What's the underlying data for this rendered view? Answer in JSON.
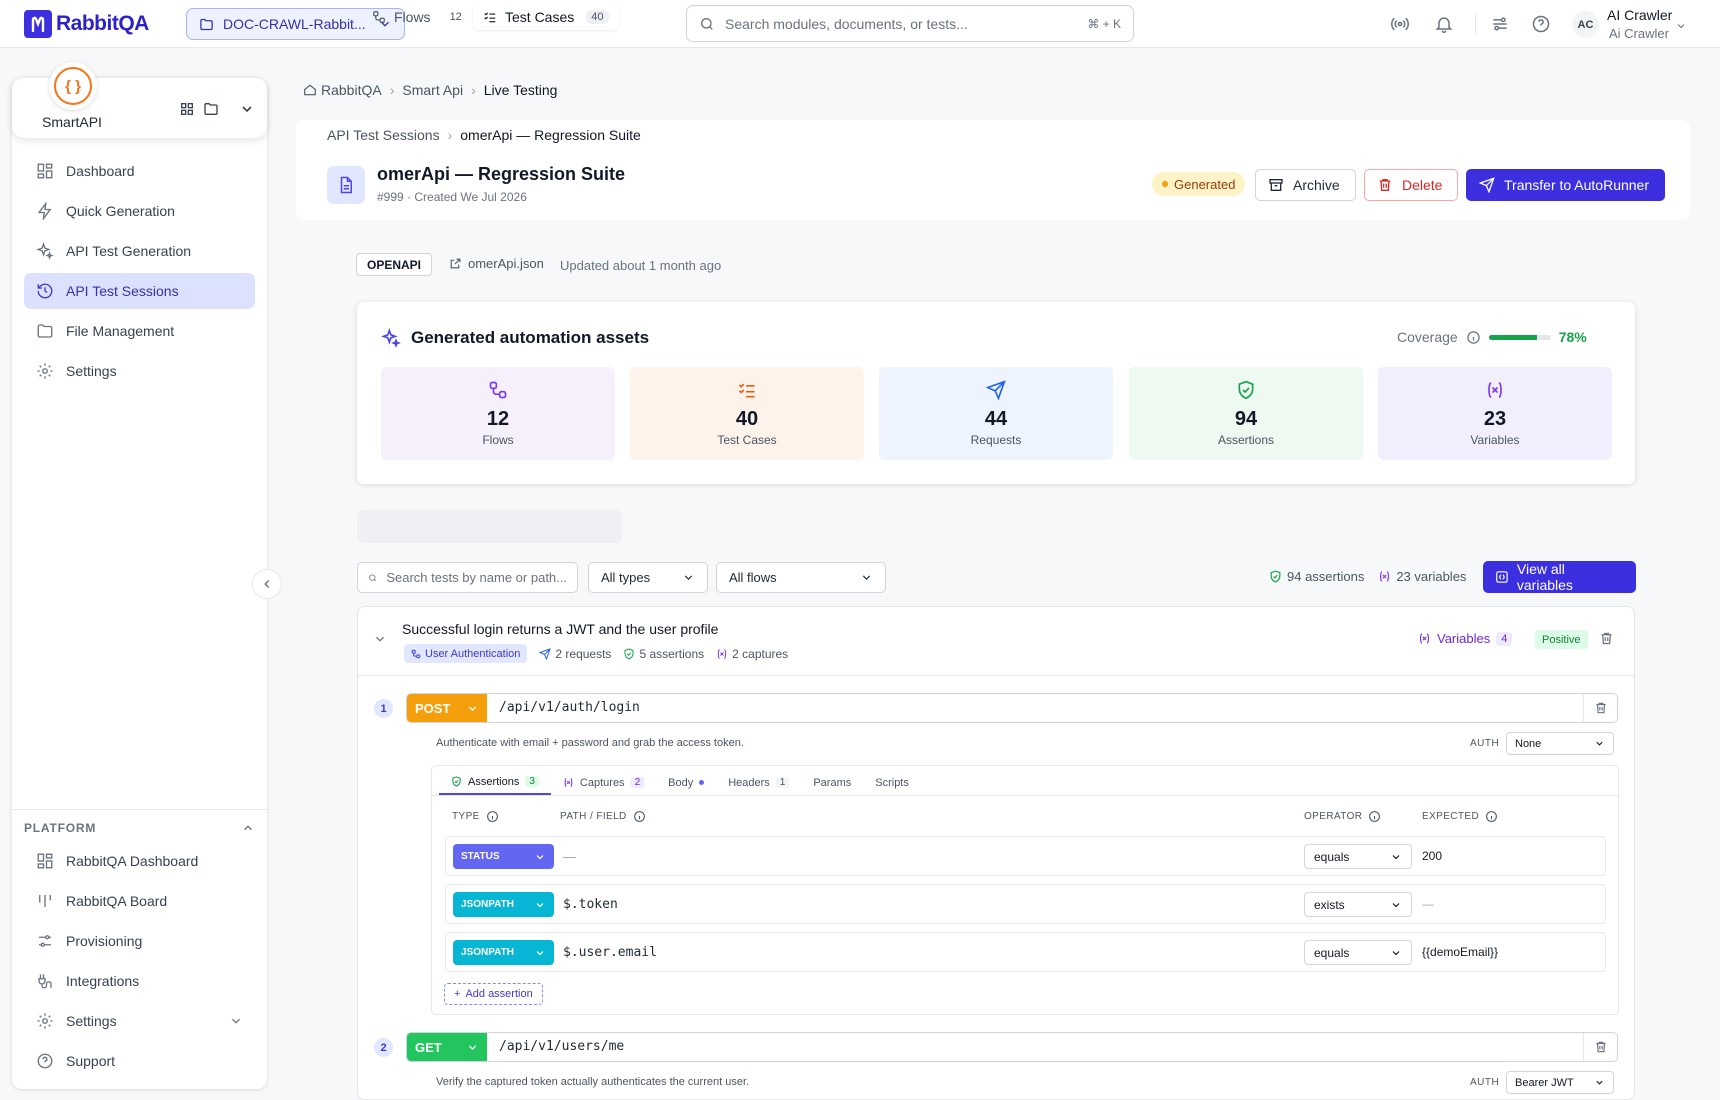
{
  "topbar": {
    "logo_text": "RabbitQA",
    "project_selector": "DOC-CRAWL-Rabbit...",
    "search_placeholder": "Search modules, documents, or tests...",
    "search_shortcut": "⌘ + K",
    "user_initials": "AC",
    "user_name": "AI Crawler",
    "user_subtitle": "Ai Crawler"
  },
  "sidebar": {
    "app_name": "SmartAPI",
    "app_icon_glyph": "{ }",
    "items": [
      {
        "label": "Dashboard",
        "icon": "dashboard-icon"
      },
      {
        "label": "Quick Generation",
        "icon": "bolt-icon"
      },
      {
        "label": "API Test Generation",
        "icon": "sparkles-icon"
      },
      {
        "label": "API Test Sessions",
        "icon": "history-icon",
        "active": true
      },
      {
        "label": "File Management",
        "icon": "folder-icon"
      },
      {
        "label": "Settings",
        "icon": "gear-icon"
      }
    ],
    "platform_heading": "PLATFORM",
    "platform_items": [
      {
        "label": "RabbitQA Dashboard",
        "icon": "dashboard-icon"
      },
      {
        "label": "RabbitQA Board",
        "icon": "board-icon"
      },
      {
        "label": "Provisioning",
        "icon": "sliders-icon"
      },
      {
        "label": "Integrations",
        "icon": "integrations-icon"
      },
      {
        "label": "Settings",
        "icon": "gear-icon"
      },
      {
        "label": "Support",
        "icon": "help-icon"
      }
    ]
  },
  "breadcrumb": [
    "RabbitQA",
    "Smart Api",
    "Live Testing"
  ],
  "session": {
    "breadcrumb_parent": "API Test Sessions",
    "breadcrumb_current": "omerApi — Regression Suite",
    "title": "omerApi — Regression Suite",
    "meta": "#999 · Created We Jul 2026",
    "status": "Generated",
    "archive_label": "Archive",
    "delete_label": "Delete",
    "transfer_label": "Transfer to AutoRunner",
    "spec_type": "OPENAPI",
    "spec_file": "omerApi.json",
    "updated": "Updated about 1 month ago"
  },
  "assets": {
    "title": "Generated automation assets",
    "coverage_label": "Coverage",
    "coverage_value": "78%",
    "coverage_fraction": 0.78,
    "stats": [
      {
        "value": "12",
        "label": "Flows",
        "icon": "flows-icon",
        "bg": "#f6f0fd",
        "color": "#7c3aed"
      },
      {
        "value": "40",
        "label": "Test Cases",
        "icon": "checklist-icon",
        "bg": "#fdf3eb",
        "color": "#ea580c"
      },
      {
        "value": "44",
        "label": "Requests",
        "icon": "send-icon",
        "bg": "#eef4fd",
        "color": "#2563eb"
      },
      {
        "value": "94",
        "label": "Assertions",
        "icon": "shield-check-icon",
        "bg": "#edf9f1",
        "color": "#16a34a"
      },
      {
        "value": "23",
        "label": "Variables",
        "icon": "variable-icon",
        "bg": "#f1effd",
        "color": "#7c3aed"
      }
    ]
  },
  "tabs": [
    {
      "label": "Flows",
      "count": "12"
    },
    {
      "label": "Test Cases",
      "count": "40",
      "active": true
    }
  ],
  "filters": {
    "search_placeholder": "Search tests by name or path...",
    "type_value": "All types",
    "flow_value": "All flows",
    "assertions_count": "94 assertions",
    "variables_count": "23 variables",
    "view_all_label": "View all variables"
  },
  "test_case": {
    "title": "Successful login returns a JWT and the user profile",
    "flow_tag": "User Authentication",
    "requests": "2 requests",
    "assertions": "5 assertions",
    "captures": "2 captures",
    "variables_label": "Variables",
    "variables_count": "4",
    "polarity": "Positive",
    "steps": [
      {
        "num": "1",
        "method": "POST",
        "method_color": "#f59e0b",
        "path": "/api/v1/auth/login",
        "description": "Authenticate with email + password and grab the access token.",
        "auth_label": "AUTH",
        "auth": "None"
      },
      {
        "num": "2",
        "method": "GET",
        "method_color": "#22c55e",
        "path": "/api/v1/users/me",
        "description": "Verify the captured token actually authenticates the current user.",
        "auth_label": "AUTH",
        "auth": "Bearer JWT"
      }
    ],
    "subtabs": [
      {
        "label": "Assertions",
        "count": "3"
      },
      {
        "label": "Captures",
        "count": "2"
      },
      {
        "label": "Body"
      },
      {
        "label": "Headers",
        "count": "1"
      },
      {
        "label": "Params"
      },
      {
        "label": "Scripts"
      }
    ],
    "columns": {
      "type": "TYPE",
      "path": "PATH / FIELD",
      "operator": "OPERATOR",
      "expected": "EXPECTED"
    },
    "assertion_rows": [
      {
        "type": "STATUS",
        "type_color": "#6366f1",
        "path": "—",
        "operator": "equals",
        "expected": "200"
      },
      {
        "type": "JSONPATH",
        "type_color": "#06b6d4",
        "path": "$.token",
        "operator": "exists",
        "expected": "—"
      },
      {
        "type": "JSONPATH",
        "type_color": "#06b6d4",
        "path": "$.user.email",
        "operator": "equals",
        "expected": "{{demoEmail}}"
      }
    ],
    "add_assertion_label": "Add assertion"
  }
}
